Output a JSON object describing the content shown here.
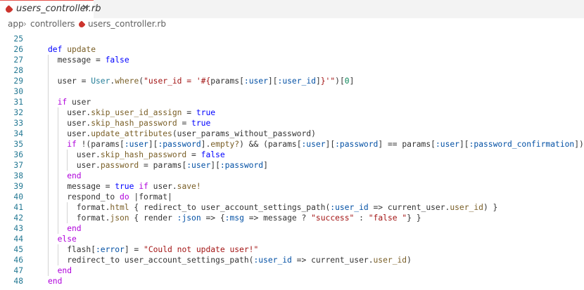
{
  "tab": {
    "filename": "users_controller.rb",
    "close_glyph": "✕",
    "icon": "ruby-file-icon",
    "accent": "#cc342d"
  },
  "breadcrumb": {
    "parts": [
      "app",
      "controllers",
      "users_controller.rb"
    ],
    "separator": "›"
  },
  "lines": [
    {
      "n": 25,
      "indent": 0,
      "tokens": []
    },
    {
      "n": 26,
      "indent": 0,
      "tokens": [
        [
          "kw2",
          "def"
        ],
        [
          "t",
          " "
        ],
        [
          "meth",
          "update"
        ]
      ]
    },
    {
      "n": 27,
      "indent": 1,
      "tokens": [
        [
          "t",
          "message = "
        ],
        [
          "kw2",
          "false"
        ]
      ]
    },
    {
      "n": 28,
      "indent": 1,
      "tokens": []
    },
    {
      "n": 29,
      "indent": 1,
      "tokens": [
        [
          "t",
          "user = "
        ],
        [
          "cls",
          "User"
        ],
        [
          "t",
          "."
        ],
        [
          "meth",
          "where"
        ],
        [
          "t",
          "("
        ],
        [
          "str",
          "\"user_id = '#{"
        ],
        [
          "t",
          "params["
        ],
        [
          "sym",
          ":user"
        ],
        [
          "t",
          "]["
        ],
        [
          "sym",
          ":user_id"
        ],
        [
          "t",
          "]"
        ],
        [
          "str",
          "}'\""
        ],
        [
          "t",
          ")["
        ],
        [
          "num",
          "0"
        ],
        [
          "t",
          "]"
        ]
      ]
    },
    {
      "n": 30,
      "indent": 1,
      "tokens": []
    },
    {
      "n": 31,
      "indent": 1,
      "tokens": [
        [
          "kw",
          "if"
        ],
        [
          "t",
          " user"
        ]
      ]
    },
    {
      "n": 32,
      "indent": 2,
      "tokens": [
        [
          "t",
          "user."
        ],
        [
          "meth",
          "skip_user_id_assign"
        ],
        [
          "t",
          " = "
        ],
        [
          "kw2",
          "true"
        ]
      ]
    },
    {
      "n": 33,
      "indent": 2,
      "tokens": [
        [
          "t",
          "user."
        ],
        [
          "meth",
          "skip_hash_password"
        ],
        [
          "t",
          " = "
        ],
        [
          "kw2",
          "true"
        ]
      ]
    },
    {
      "n": 34,
      "indent": 2,
      "tokens": [
        [
          "t",
          "user."
        ],
        [
          "meth",
          "update_attributes"
        ],
        [
          "t",
          "(user_params_without_password)"
        ]
      ]
    },
    {
      "n": 35,
      "indent": 2,
      "tokens": [
        [
          "kw",
          "if"
        ],
        [
          "t",
          " !(params["
        ],
        [
          "sym",
          ":user"
        ],
        [
          "t",
          "]["
        ],
        [
          "sym",
          ":password"
        ],
        [
          "t",
          "]."
        ],
        [
          "meth",
          "empty?"
        ],
        [
          "t",
          ") && (params["
        ],
        [
          "sym",
          ":user"
        ],
        [
          "t",
          "]["
        ],
        [
          "sym",
          ":password"
        ],
        [
          "t",
          "] == params["
        ],
        [
          "sym",
          ":user"
        ],
        [
          "t",
          "]["
        ],
        [
          "sym",
          ":password_confirmation"
        ],
        [
          "t",
          "])"
        ]
      ]
    },
    {
      "n": 36,
      "indent": 3,
      "tokens": [
        [
          "t",
          "user."
        ],
        [
          "meth",
          "skip_hash_password"
        ],
        [
          "t",
          " = "
        ],
        [
          "kw2",
          "false"
        ]
      ]
    },
    {
      "n": 37,
      "indent": 3,
      "tokens": [
        [
          "t",
          "user."
        ],
        [
          "meth",
          "password"
        ],
        [
          "t",
          " = params["
        ],
        [
          "sym",
          ":user"
        ],
        [
          "t",
          "]["
        ],
        [
          "sym",
          ":password"
        ],
        [
          "t",
          "]"
        ]
      ]
    },
    {
      "n": 38,
      "indent": 2,
      "tokens": [
        [
          "kw",
          "end"
        ]
      ]
    },
    {
      "n": 39,
      "indent": 2,
      "tokens": [
        [
          "t",
          "message = "
        ],
        [
          "kw2",
          "true"
        ],
        [
          "t",
          " "
        ],
        [
          "kw",
          "if"
        ],
        [
          "t",
          " user."
        ],
        [
          "meth",
          "save!"
        ]
      ]
    },
    {
      "n": 40,
      "indent": 2,
      "tokens": [
        [
          "t",
          "respond_to "
        ],
        [
          "kw",
          "do"
        ],
        [
          "t",
          " |format|"
        ]
      ]
    },
    {
      "n": 41,
      "indent": 3,
      "tokens": [
        [
          "t",
          "format."
        ],
        [
          "meth",
          "html"
        ],
        [
          "t",
          " { redirect_to user_account_settings_path("
        ],
        [
          "sym",
          ":user_id"
        ],
        [
          "t",
          " => current_user."
        ],
        [
          "meth",
          "user_id"
        ],
        [
          "t",
          ") }"
        ]
      ]
    },
    {
      "n": 42,
      "indent": 3,
      "tokens": [
        [
          "t",
          "format."
        ],
        [
          "meth",
          "json"
        ],
        [
          "t",
          " { render "
        ],
        [
          "sym",
          ":json"
        ],
        [
          "t",
          " => {"
        ],
        [
          "sym",
          ":msg"
        ],
        [
          "t",
          " => message ? "
        ],
        [
          "str",
          "\"success\""
        ],
        [
          "t",
          " : "
        ],
        [
          "str",
          "\"false \""
        ],
        [
          "t",
          "} }"
        ]
      ]
    },
    {
      "n": 43,
      "indent": 2,
      "tokens": [
        [
          "kw",
          "end"
        ]
      ]
    },
    {
      "n": 44,
      "indent": 1,
      "tokens": [
        [
          "kw",
          "else"
        ]
      ]
    },
    {
      "n": 45,
      "indent": 2,
      "tokens": [
        [
          "t",
          "flash["
        ],
        [
          "sym",
          ":error"
        ],
        [
          "t",
          "] = "
        ],
        [
          "str",
          "\"Could not update user!\""
        ]
      ]
    },
    {
      "n": 46,
      "indent": 2,
      "tokens": [
        [
          "t",
          "redirect_to user_account_settings_path("
        ],
        [
          "sym",
          ":user_id"
        ],
        [
          "t",
          " => current_user."
        ],
        [
          "meth",
          "user_id"
        ],
        [
          "t",
          ")"
        ]
      ]
    },
    {
      "n": 47,
      "indent": 1,
      "tokens": [
        [
          "kw",
          "end"
        ]
      ]
    },
    {
      "n": 48,
      "indent": 0,
      "tokens": [
        [
          "kw",
          "end"
        ]
      ]
    }
  ]
}
